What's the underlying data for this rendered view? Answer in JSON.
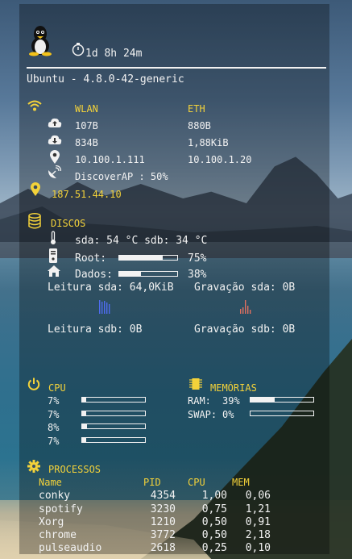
{
  "colors": {
    "accent": "#f3d23a",
    "text": "#f2f2f2"
  },
  "uptime": "1d 8h 24m",
  "kernel": "Ubuntu - 4.8.0-42-generic",
  "network": {
    "wlan_label": "WLAN",
    "eth_label": "ETH",
    "wlan_up": "107B",
    "wlan_down": "834B",
    "wlan_ip": "10.100.1.111",
    "eth_up": "880B",
    "eth_down": "1,88KiB",
    "eth_ip": "10.100.1.20",
    "ap": "DiscoverAP : 50%",
    "public_ip": "187.51.44.10"
  },
  "disks": {
    "title": "DISCOS",
    "temps": "sda: 54 °C sdb: 34 °C",
    "root_label": "Root:",
    "root_pct": "75%",
    "root_value": 0.75,
    "data_label": "Dados:",
    "data_pct": "38%",
    "data_value": 0.38,
    "read_sda": "Leitura sda: 64,0KiB",
    "write_sda": "Gravação sda: 0B",
    "read_sdb": "Leitura sdb: 0B",
    "write_sdb": "Gravação sdb: 0B"
  },
  "cpu": {
    "title": "CPU",
    "cores": [
      {
        "label": "7%",
        "value": 0.07
      },
      {
        "label": "7%",
        "value": 0.07
      },
      {
        "label": "8%",
        "value": 0.08
      },
      {
        "label": "7%",
        "value": 0.07
      }
    ]
  },
  "memory": {
    "title": "MEMÓRIAS",
    "ram_label": "RAM:",
    "ram_pct": "39%",
    "ram_value": 0.39,
    "swap_label": "SWAP:",
    "swap_pct": "0%",
    "swap_value": 0.0
  },
  "processes": {
    "title": "PROCESSOS",
    "headers": {
      "name": "Name",
      "pid": "PID",
      "cpu": "CPU",
      "mem": "MEM"
    },
    "rows": [
      {
        "name": "conky",
        "pid": "4354",
        "cpu": "1,00",
        "mem": "0,06"
      },
      {
        "name": "spotify",
        "pid": "3230",
        "cpu": "0,75",
        "mem": "1,21"
      },
      {
        "name": "Xorg",
        "pid": "1210",
        "cpu": "0,50",
        "mem": "0,91"
      },
      {
        "name": "chrome",
        "pid": "3772",
        "cpu": "0,50",
        "mem": "2,18"
      },
      {
        "name": "pulseaudio",
        "pid": "2618",
        "cpu": "0,25",
        "mem": "0,10"
      }
    ]
  }
}
